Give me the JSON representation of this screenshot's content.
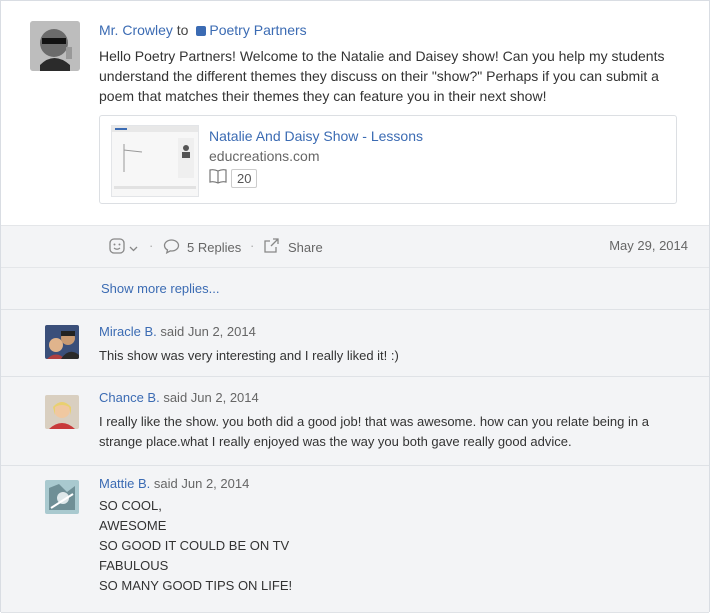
{
  "post": {
    "author": "Mr. Crowley",
    "to_word": "to",
    "group": "Poetry Partners",
    "body": "Hello Poetry Partners! Welcome to the Natalie and Daisey show! Can you help my students understand the different themes they discuss on their \"show?\" Perhaps if you can submit a poem that matches their themes they can feature you in their next show!",
    "attachment": {
      "title": "Natalie And Daisy Show - Lessons",
      "domain": "educreations.com",
      "count": "20"
    }
  },
  "actions": {
    "replies_label": "5 Replies",
    "share_label": "Share",
    "date": "May 29, 2014"
  },
  "replies": {
    "show_more": "Show more replies...",
    "items": [
      {
        "name": "Miracle B.",
        "said": "said Jun 2, 2014",
        "text": "This show was very interesting and I really liked it! :)"
      },
      {
        "name": "Chance B.",
        "said": "said Jun 2, 2014",
        "text": "I really like the show. you both did a good job! that was awesome. how can you relate being in a strange place.what I really enjoyed was the way you both gave really good advice."
      },
      {
        "name": "Mattie B.",
        "said": "said Jun 2, 2014",
        "text": "SO COOL,\nAWESOME\nSO GOOD IT COULD BE ON TV\nFABULOUS\nSO MANY GOOD TIPS ON LIFE!"
      }
    ]
  }
}
